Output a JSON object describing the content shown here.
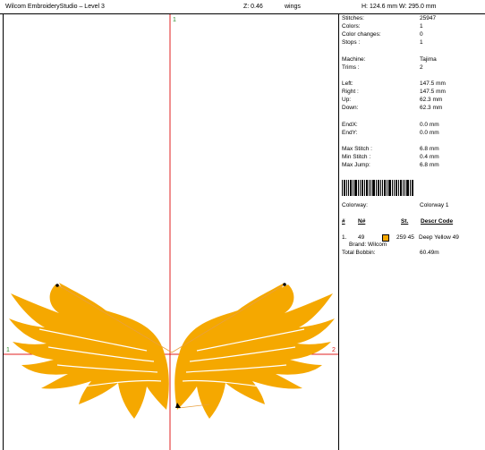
{
  "app": {
    "title": "Wilcom EmbroideryStudio – Level 3",
    "zoom": "Z: 0.46",
    "design_name": "wings",
    "size": "H: 124.6 mm  W: 295.0 mm"
  },
  "canvas": {
    "marker_top": "1",
    "marker_left": "1",
    "marker_right": "2",
    "wing_color": "#f5a800",
    "guide_color": "#e02020",
    "path_color": "#e8a040"
  },
  "stats": [
    {
      "label": "Stitches:",
      "value": "25947"
    },
    {
      "label": "Colors:",
      "value": "1"
    },
    {
      "label": "Color changes:",
      "value": "0"
    },
    {
      "label": "Stops :",
      "value": "1"
    },
    {
      "label": "Machine:",
      "value": "Tajima"
    },
    {
      "label": "Trims :",
      "value": "2"
    },
    {
      "label": "Left:",
      "value": "147.5 mm"
    },
    {
      "label": "Right :",
      "value": "147.5 mm"
    },
    {
      "label": "Up:",
      "value": "62.3 mm"
    },
    {
      "label": "Down:",
      "value": "62.3 mm"
    },
    {
      "label": "EndX:",
      "value": "0.0 mm"
    },
    {
      "label": "EndY:",
      "value": "0.0 mm"
    },
    {
      "label": "Max Stitch :",
      "value": "6.8 mm"
    },
    {
      "label": "Min Stitch :",
      "value": "0.4 mm"
    },
    {
      "label": "Max Jump:",
      "value": "6.8 mm"
    }
  ],
  "colorway": {
    "label": "Colorway:",
    "value": "Colorway 1"
  },
  "table": {
    "headers": [
      "#",
      "N#",
      "St.",
      "Descr  Code"
    ],
    "row": {
      "num": "1.",
      "needle": "49",
      "stitches": "259 45",
      "descr": "Deep Yellow 49",
      "color": "#f5a800"
    },
    "brand": "Brand: Wilcom"
  },
  "bobbin": {
    "label": "Total Bobbin:",
    "value": "60.49m"
  }
}
